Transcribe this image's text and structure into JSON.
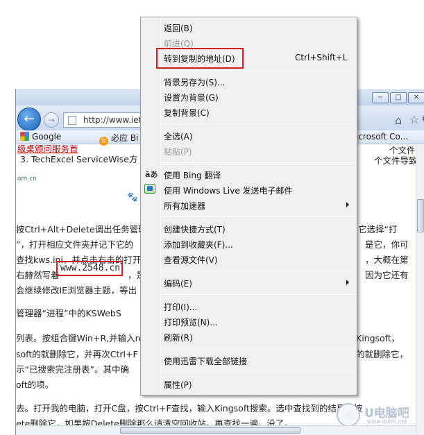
{
  "browser": {
    "window_buttons": {
      "minimize": "−",
      "maximize": "□",
      "close": "✕"
    },
    "address_text": "http://www.iefa",
    "favorites": [
      {
        "label": "Google"
      },
      {
        "label": "必应 Bi"
      },
      {
        "label": "icrosoft Co..."
      }
    ],
    "content_lines": [
      "级桌颁问服务首",
      "3. TechExcel ServiceWise方",
      "个文件大",
      "个文件导致",
      "om.cn",
      "百",
      "按Ctrl+Alt+Delete调出任务管理",
      "它选择“打",
      "”，打开相应文件夹并记下它的",
      "是它，你可",
      "查找kws.ini，并点击右击的打开",
      "，大概在第",
      "右赫然写着",
      "www.2548.cn",
      "，是",
      "因为它还有",
      "会继续修改IE浏览器主题，等出",
      "管理器“进程”中的KSWebS",
      "列表。按组合键Win+R,并输入re",
      "Kingsoft，",
      "soft的就删除它，并再次Ctrl+F",
      "的就删除它，",
      "示“已搜索完注册表”。其中确",
      "oft的项。",
      "去。打开我的电脑，打开C盘，按Ctrl+F查找，输入Kingsoft搜索。选中查找到的结果，按",
      "ete删除它，如果按Delete删除那么请清空回收站。再查找一遍，没了。"
    ],
    "watermark": {
      "text": "U电脑吧",
      "url": "www.dnb8.net"
    }
  },
  "context_menu": {
    "items": [
      {
        "label": "返回(B)",
        "enabled": true
      },
      {
        "label": "前进(Q)",
        "enabled": false
      },
      {
        "label": "转到复制的地址(D)",
        "shortcut": "Ctrl+Shift+L",
        "enabled": true
      },
      {
        "label": "背景另存为(S)...",
        "enabled": true
      },
      {
        "label": "设置为背景(G)",
        "enabled": true
      },
      {
        "label": "复制背景(C)",
        "enabled": true
      },
      {
        "label": "全选(A)",
        "enabled": true
      },
      {
        "label": "粘贴(P)",
        "enabled": false
      },
      {
        "label": "使用 Bing 翻译",
        "enabled": true
      },
      {
        "label": "使用 Windows Live 发送电子邮件",
        "enabled": true
      },
      {
        "label": "所有加速器",
        "enabled": true,
        "submenu": true
      },
      {
        "label": "创建快捷方式(T)",
        "enabled": true
      },
      {
        "label": "添加到收藏夹(F)...",
        "enabled": true
      },
      {
        "label": "查看源文件(V)",
        "enabled": true
      },
      {
        "label": "编码(E)",
        "enabled": true,
        "submenu": true
      },
      {
        "label": "打印(I)...",
        "enabled": true
      },
      {
        "label": "打印预览(N)...",
        "enabled": true
      },
      {
        "label": "刷新(R)",
        "enabled": true
      },
      {
        "label": "使用迅雷下载全部链接",
        "enabled": true
      },
      {
        "label": "属性(P)",
        "enabled": true
      }
    ],
    "bing_icon_glyph": "āあ"
  },
  "colors": {
    "highlight_red": "#d51d22",
    "menu_bg": "#f0f0f0",
    "link_red": "#cc0000"
  }
}
